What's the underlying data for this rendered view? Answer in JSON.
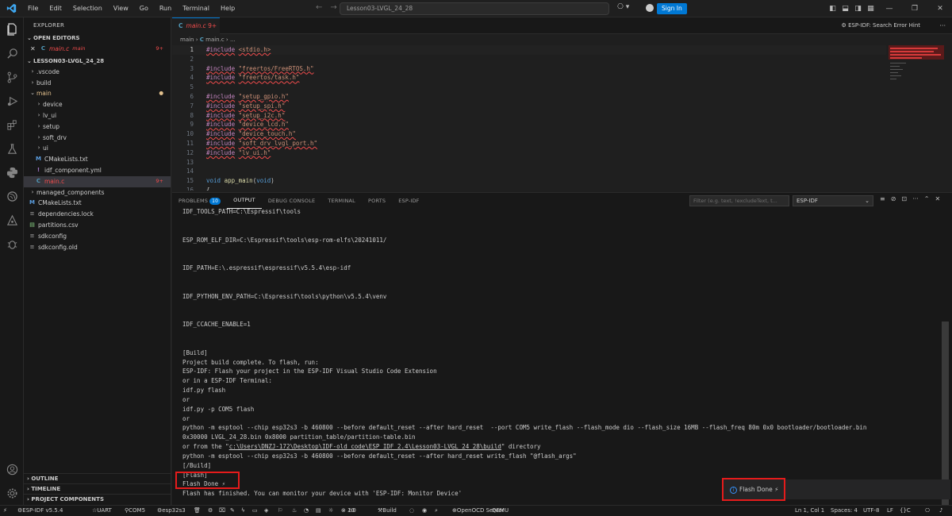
{
  "titlebar": {
    "menu": [
      "File",
      "Edit",
      "Selection",
      "View",
      "Go",
      "Run",
      "Terminal",
      "Help"
    ],
    "search": "Lesson03-LVGL_24_28",
    "signin": "Sign In"
  },
  "sidebar": {
    "title": "EXPLORER",
    "open_editors": "OPEN EDITORS",
    "open_file": "main.c",
    "open_file_dir": "main",
    "open_file_badge": "9+",
    "project": "LESSON03-LVGL_24_28",
    "tree": [
      {
        "label": ".vscode",
        "type": "folder",
        "depth": 1
      },
      {
        "label": "build",
        "type": "folder",
        "depth": 1
      },
      {
        "label": "main",
        "type": "folder-open",
        "depth": 1,
        "mod": "dot"
      },
      {
        "label": "device",
        "type": "folder",
        "depth": 2
      },
      {
        "label": "lv_ui",
        "type": "folder",
        "depth": 2
      },
      {
        "label": "setup",
        "type": "folder",
        "depth": 2
      },
      {
        "label": "soft_drv",
        "type": "folder",
        "depth": 2
      },
      {
        "label": "ui",
        "type": "folder",
        "depth": 2
      },
      {
        "label": "CMakeLists.txt",
        "type": "cmake",
        "depth": 2
      },
      {
        "label": "idf_component.yml",
        "type": "yml",
        "depth": 2
      },
      {
        "label": "main.c",
        "type": "c",
        "depth": 2,
        "mod": "9+"
      },
      {
        "label": "managed_components",
        "type": "folder",
        "depth": 1
      },
      {
        "label": "CMakeLists.txt",
        "type": "cmake",
        "depth": 1
      },
      {
        "label": "dependencies.lock",
        "type": "lock",
        "depth": 1
      },
      {
        "label": "partitions.csv",
        "type": "csv",
        "depth": 1
      },
      {
        "label": "sdkconfig",
        "type": "cfg",
        "depth": 1
      },
      {
        "label": "sdkconfig.old",
        "type": "cfg",
        "depth": 1
      }
    ],
    "outline": "OUTLINE",
    "timeline": "TIMELINE",
    "project_components": "PROJECT COMPONENTS"
  },
  "editor": {
    "tab_label": "main.c",
    "tab_badge": "9+",
    "right_action": "ESP-IDF: Search Error Hint",
    "breadcrumb_dir": "main",
    "breadcrumb_file": "main.c",
    "breadcrumb_more": "...",
    "lines": [
      {
        "n": "1",
        "t": "#include <stdio.h>"
      },
      {
        "n": "2",
        "t": ""
      },
      {
        "n": "3",
        "t": "#include \"freertos/FreeRTOS.h\""
      },
      {
        "n": "4",
        "t": "#include \"freertos/task.h\""
      },
      {
        "n": "5",
        "t": ""
      },
      {
        "n": "6",
        "t": "#include \"setup_gpio.h\""
      },
      {
        "n": "7",
        "t": "#include \"setup_spi.h\""
      },
      {
        "n": "8",
        "t": "#include \"setup_i2c.h\""
      },
      {
        "n": "9",
        "t": "#include \"device_lcd.h\""
      },
      {
        "n": "10",
        "t": "#include \"device_touch.h\""
      },
      {
        "n": "11",
        "t": "#include \"soft_drv_lvgl_port.h\""
      },
      {
        "n": "12",
        "t": "#include \"lv_ui.h\""
      },
      {
        "n": "13",
        "t": ""
      },
      {
        "n": "14",
        "t": ""
      },
      {
        "n": "15",
        "t": "void app_main(void)"
      },
      {
        "n": "16",
        "t": "{"
      }
    ]
  },
  "panel": {
    "tabs": [
      "PROBLEMS",
      "OUTPUT",
      "DEBUG CONSOLE",
      "TERMINAL",
      "PORTS",
      "ESP-IDF"
    ],
    "problems_count": "10",
    "filter_placeholder": "Filter (e.g. text, !excludeText, t...",
    "channel": "ESP-IDF",
    "output": [
      "IDF_TOOLS_PATH=C:\\Espressif\\tools",
      "",
      "",
      "ESP_ROM_ELF_DIR=C:\\Espressif\\tools\\esp-rom-elfs\\20241011/",
      "",
      "",
      "IDF_PATH=E:\\.espressif\\espressif\\v5.5.4\\esp-idf",
      "",
      "",
      "IDF_PYTHON_ENV_PATH=C:\\Espressif\\tools\\python\\v5.5.4\\venv",
      "",
      "",
      "IDF_CCACHE_ENABLE=1",
      "",
      "",
      "[Build]",
      "Project build complete. To flash, run:",
      "ESP-IDF: Flash your project in the ESP-IDF Visual Studio Code Extension",
      "or in a ESP-IDF Terminal:",
      "idf.py flash",
      "or",
      "idf.py -p COM5 flash",
      "or",
      "python -m esptool --chip esp32s3 -b 460800 --before default_reset --after hard_reset  --port COM5 write_flash --flash_mode dio --flash_size 16MB --flash_freq 80m 0x0 bootloader/bootloader.bin",
      "0x30000 LVGL_24_28.bin 0x8000 partition_table/partition-table.bin"
    ],
    "from_prefix": "or from the \"",
    "from_path": "c:\\Users\\DNZJ-172\\Desktop\\IDF-old_code\\ESP_IDF_2.4\\Lesson03-LVGL_24_28\\build",
    "from_suffix": "\" directory",
    "output_tail": [
      "python -m esptool --chip esp32s3 -b 460800 --before default_reset --after hard_reset write_flash \"@flash_args\"",
      "[/Build]",
      "[Flash]"
    ],
    "flash_done": "Flash Done ⚡",
    "flash_finished": "Flash has finished. You can monitor your device with 'ESP-IDF: Monitor Device'",
    "toast": "Flash Done ⚡"
  },
  "statusbar": {
    "idf": "ESP-IDF v5.5.4",
    "uart": "UART",
    "port": "COM5",
    "target": "esp32s3",
    "num": "10",
    "errors": "0",
    "build": "Build",
    "openocd": "OpenOCD Server",
    "qemu": "QEMU",
    "position": "Ln 1, Col 1",
    "spaces": "Spaces: 4",
    "encoding": "UTF-8",
    "eol": "LF",
    "lang": "C"
  },
  "colors": {
    "accent": "#0078d4",
    "highlight": "#e51b1b",
    "error": "#f14c4c",
    "modified": "#e2c08d"
  }
}
